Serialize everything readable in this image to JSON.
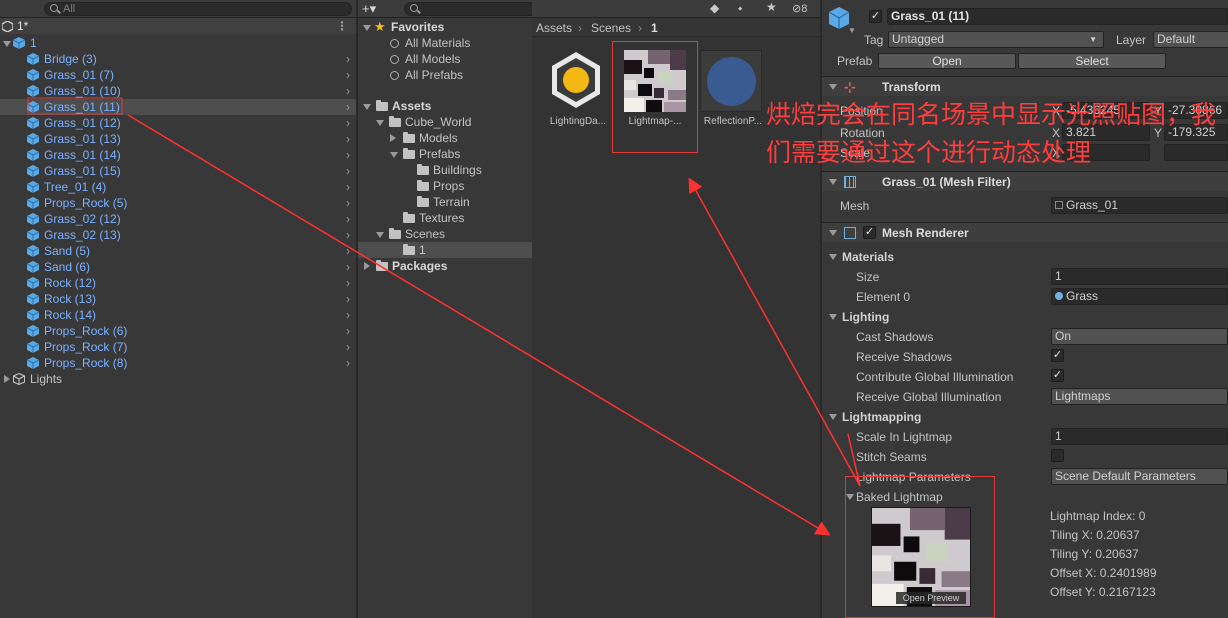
{
  "hierarchy": {
    "search_placeholder": "All",
    "scene_name": "1*",
    "root": "1",
    "items": [
      "Bridge (3)",
      "Grass_01 (7)",
      "Grass_01 (10)",
      "Grass_01 (11)",
      "Grass_01 (12)",
      "Grass_01 (13)",
      "Grass_01 (14)",
      "Grass_01 (15)",
      "Tree_01 (4)",
      "Props_Rock (5)",
      "Grass_02 (12)",
      "Grass_02 (13)",
      "Sand (5)",
      "Sand (6)",
      "Rock (12)",
      "Rock (13)",
      "Rock (14)",
      "Props_Rock (6)",
      "Props_Rock (7)",
      "Props_Rock (8)"
    ],
    "selected": "Grass_01 (11)",
    "lights": "Lights"
  },
  "project": {
    "add_label": "+▾",
    "hidden_count": "8",
    "favorites": "Favorites",
    "fav_items": [
      "All Materials",
      "All Models",
      "All Prefabs"
    ],
    "assets": "Assets",
    "cube_world": "Cube_World",
    "models": "Models",
    "prefabs": "Prefabs",
    "buildings": "Buildings",
    "props": "Props",
    "terrain": "Terrain",
    "textures": "Textures",
    "scenes": "Scenes",
    "scene1": "1",
    "packages": "Packages"
  },
  "assets_pane": {
    "breadcrumb": [
      "Assets",
      "Scenes",
      "1"
    ],
    "items": [
      "LightingDa...",
      "Lightmap-...",
      "ReflectionP..."
    ]
  },
  "inspector": {
    "object_name": "Grass_01 (11)",
    "tag_label": "Tag",
    "tag_value": "Untagged",
    "layer_label": "Layer",
    "layer_value": "Default",
    "prefab_label": "Prefab",
    "open_label": "Open",
    "select_label": "Select",
    "transform": "Transform",
    "position": "Position",
    "pos_x": "-5.436245",
    "pos_y": "-27.30866",
    "rotation": "Rotation",
    "rot_x": "3.821",
    "rot_y": "-179.325",
    "scale": "Scale",
    "mesh_filter": "Grass_01 (Mesh Filter)",
    "mesh_label": "Mesh",
    "mesh_value": "Grass_01",
    "mesh_renderer": "Mesh Renderer",
    "materials": "Materials",
    "size_label": "Size",
    "size_value": "1",
    "element0_label": "Element 0",
    "element0_value": "Grass",
    "lighting": "Lighting",
    "cast_shadows": "Cast Shadows",
    "cast_value": "On",
    "receive_shadows": "Receive Shadows",
    "contribute_gi": "Contribute Global Illumination",
    "receive_gi": "Receive Global Illumination",
    "receive_gi_value": "Lightmaps",
    "lightmapping": "Lightmapping",
    "scale_lightmap": "Scale In Lightmap",
    "scale_lightmap_value": "1",
    "stitch_seams": "Stitch Seams",
    "lightmap_params": "Lightmap Parameters",
    "lightmap_params_value": "Scene Default Parameters",
    "baked_lightmap": "Baked Lightmap",
    "open_preview": "Open Preview",
    "lm_index": "Lightmap Index: 0",
    "tiling_x": "Tiling X: 0.20637",
    "tiling_y": "Tiling Y: 0.20637",
    "offset_x": "Offset X: 0.2401989",
    "offset_y": "Offset Y: 0.2167123"
  },
  "annotation": "烘焙完会在同名场景中显示光照贴图，我们需要通过这个进行动态处理",
  "colors": {
    "accent_blue": "#7cb2ff",
    "annotation_red": "#ff3d3d",
    "selection": "#4d4d4d"
  }
}
